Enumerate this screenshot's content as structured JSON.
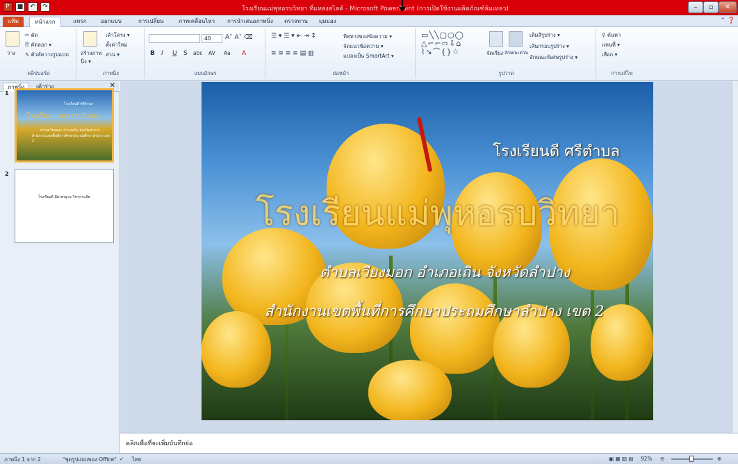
{
  "window": {
    "title": "โรงเรียนแม่พุหอรบวิทยา  ที่แหล่งสไลด์ - Microsoft PowerPoint (การเปิดใช้งานผลิตภัณฑ์ล้มเหลว)",
    "min_label": "–",
    "max_label": "▫",
    "close_label": "✕"
  },
  "qat": {
    "icons": [
      "powerpoint-icon",
      "save-icon",
      "undo-icon",
      "redo-icon"
    ]
  },
  "tabs": {
    "file": "แฟ้ม",
    "home": "หน้าแรก",
    "insert": "แทรก",
    "design": "ออกแบบ",
    "transitions": "การเปลี่ยน",
    "animations": "ภาพเคลื่อนไหว",
    "slideshow": "การนำเสนอภาพนิ่ง",
    "review": "ตรวจทาน",
    "view": "มุมมอง"
  },
  "ribbon": {
    "clipboard": {
      "label": "คลิปบอร์ด",
      "paste": "วาง",
      "cut": "ตัด",
      "copy": "คัดลอก ▾",
      "format": "ตัวคัดวางรูปแบบ"
    },
    "slides": {
      "label": "ภาพนิ่ง",
      "new": "สร้างภาพนิ่ง ▾",
      "layout": "เค้าโครง ▾",
      "reset": "ตั้งค่าใหม่",
      "section": "ส่วน ▾"
    },
    "font": {
      "label": "แบบอักษร",
      "size": "40",
      "bold": "B",
      "italic": "I",
      "underline": "U",
      "strike": "S",
      "shadow": "abc",
      "spacing": "AV",
      "case": "Aa",
      "color": "A"
    },
    "paragraph": {
      "label": "ย่อหน้า",
      "text_direction": "ทิศทางของข้อความ ▾",
      "align_text": "จัดแนวข้อความ ▾",
      "smartart": "แปลงเป็น SmartArt ▾"
    },
    "drawing": {
      "label": "รูปวาด",
      "shapes": "▭╲╲▢○◯\n△⌐⌐⇨⇩⌂\n⌇↘⌒{}☆",
      "arrange": "จัดเรียง",
      "quick_styles": "ลักษณะด่วน",
      "fill": "เติมสีรูปร่าง ▾",
      "outline": "เส้นกรอบรูปร่าง ▾",
      "effects": "ลักษณะพิเศษรูปร่าง ▾"
    },
    "editing": {
      "label": "การแก้ไข",
      "find": "ค้นหา",
      "replace": "แทนที่ ▾",
      "select": "เลือก ▾"
    }
  },
  "left_panel": {
    "tab_slides": "ภาพนิ่ง",
    "tab_outline": "เค้าร่าง",
    "close": "✕",
    "thumbs": [
      {
        "num": "1",
        "title": "โรงเรียนดี ศรีตำบล",
        "big": "โรงเรียนแม่พุหอรบวิทยา",
        "sub": "ตำบลเวียงมอก อำเภอเถิน จังหวัดลำปาง",
        "sub2": "สำนักงานเขตพื้นที่การศึกษาประถมศึกษาลำปาง เขต 2"
      },
      {
        "num": "2",
        "text": "โรงเรียนดี มีมาตรฐาน วิชาการเลิศ"
      }
    ]
  },
  "slide": {
    "subtitle_top": "โรงเรียนดี ศรีตำบล",
    "main_title": "โรงเรียนแม่พุหอรบวิทยา",
    "line2": "ตำบลเวียงมอก อำเภอเถิน จังหวัดลำปาง",
    "line3": "สำนักงานเขตพื้นที่การศึกษาประถมศึกษาลำปาง เขต 2"
  },
  "notes": {
    "placeholder": "คลิกเพื่อที่จะเพิ่มบันทึกย่อ"
  },
  "status": {
    "slide_of": "ภาพนิ่ง 1 จาก 2",
    "theme": "\"ชุดรูปแบบของ Office\"",
    "lang": "ไทย",
    "zoom": "92%",
    "zoom_out": "⊖",
    "zoom_in": "⊕"
  }
}
